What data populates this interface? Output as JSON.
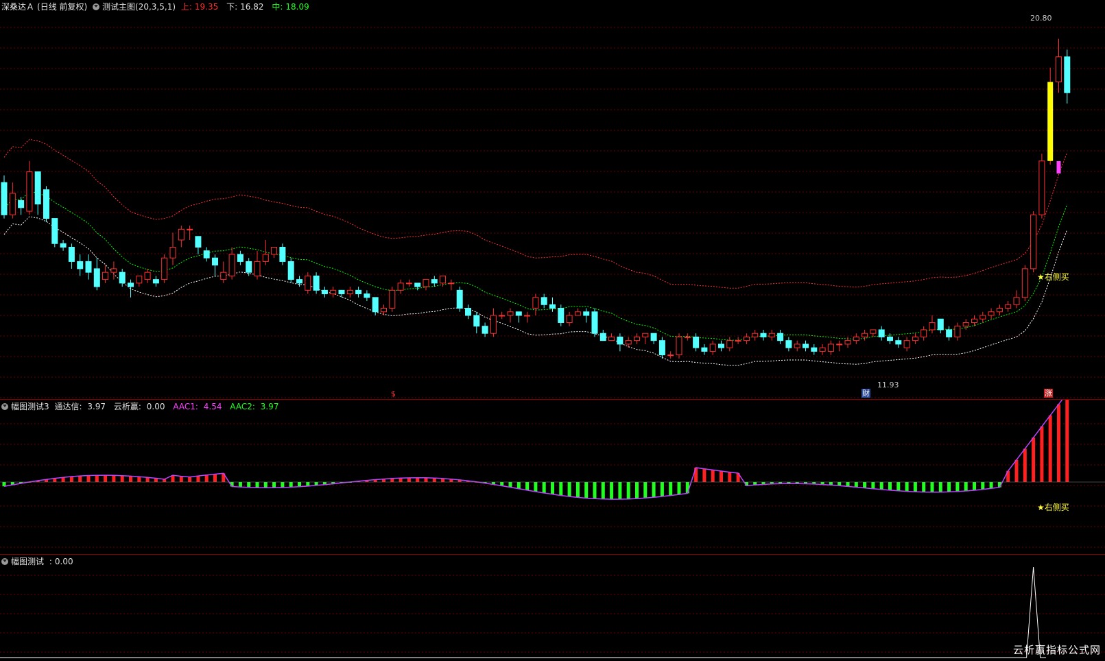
{
  "main": {
    "stock_name": "深桑达Ａ",
    "period": "(日线 前复权)",
    "indicator_name": "测试主图(20,3,5,1)",
    "upper_label": "上:",
    "upper_value": "19.35",
    "lower_label": "下:",
    "lower_value": "16.82",
    "mid_label": "中:",
    "mid_value": "18.09",
    "high_price_label": "20.80",
    "low_price_label": "11.93",
    "signal_text": "★右侧买",
    "marker_dollar": "$",
    "marker_cai": "财",
    "marker_zhang": "涨"
  },
  "sub1": {
    "title": "幅图测试3",
    "tdx_label": "通达信:",
    "tdx_value": "3.97",
    "yxy_label": "云析赢:",
    "yxy_value": "0.00",
    "aac1_label": "AAC1:",
    "aac1_value": "4.54",
    "aac2_label": "AAC2:",
    "aac2_value": "3.97",
    "signal_text": "★右侧买"
  },
  "sub2": {
    "title": "幅图测试",
    "value_label": ":",
    "value": "0.00"
  },
  "watermark": "云析赢指标公式网",
  "colors": {
    "up": "#ff3030",
    "down": "#54ffff",
    "upper_band": "#ff3030",
    "mid_band": "#00ff00",
    "lower_band": "#ffffff",
    "signal": "#ffff00",
    "macd_pos": "#ff2020",
    "macd_neg": "#20ff20",
    "magenta": "#ff40ff"
  },
  "chart_data": {
    "type": "candlestick",
    "y_range": [
      11.0,
      21.5
    ],
    "high": 20.8,
    "low": 11.93,
    "bars": [
      [
        16.8,
        15.9,
        17.0,
        15.8
      ],
      [
        15.9,
        16.5,
        16.8,
        15.8
      ],
      [
        16.3,
        16.1,
        16.4,
        15.9
      ],
      [
        16.0,
        17.1,
        17.4,
        15.9
      ],
      [
        17.1,
        16.2,
        17.1,
        15.9
      ],
      [
        16.6,
        15.8,
        16.7,
        15.7
      ],
      [
        15.8,
        15.1,
        15.8,
        15.0
      ],
      [
        15.1,
        15.0,
        15.2,
        14.9
      ],
      [
        15.0,
        14.6,
        15.1,
        14.4
      ],
      [
        14.6,
        14.4,
        14.8,
        14.2
      ],
      [
        14.6,
        14.3,
        14.8,
        14.1
      ],
      [
        14.4,
        13.9,
        14.7,
        13.8
      ],
      [
        14.1,
        14.3,
        14.5,
        14.0
      ],
      [
        14.3,
        14.4,
        14.6,
        14.1
      ],
      [
        14.3,
        14.0,
        14.4,
        13.9
      ],
      [
        14.0,
        13.9,
        14.1,
        13.6
      ],
      [
        14.0,
        14.2,
        14.2,
        13.9
      ],
      [
        14.1,
        14.3,
        14.4,
        14.0
      ],
      [
        14.1,
        14.0,
        14.2,
        13.9
      ],
      [
        14.1,
        14.7,
        14.8,
        14.0
      ],
      [
        14.7,
        15.0,
        15.4,
        14.5
      ],
      [
        15.2,
        15.5,
        15.6,
        15.0
      ],
      [
        15.5,
        15.5,
        15.6,
        15.2
      ],
      [
        15.3,
        15.0,
        15.3,
        14.8
      ],
      [
        14.9,
        14.7,
        15.0,
        14.6
      ],
      [
        14.7,
        14.5,
        14.8,
        14.2
      ],
      [
        14.1,
        14.3,
        14.6,
        14.0
      ],
      [
        14.2,
        14.8,
        15.0,
        14.1
      ],
      [
        14.8,
        14.6,
        14.9,
        14.5
      ],
      [
        14.6,
        14.3,
        14.7,
        14.2
      ],
      [
        14.2,
        14.6,
        14.9,
        14.1
      ],
      [
        14.6,
        14.8,
        15.2,
        14.5
      ],
      [
        14.8,
        15.0,
        15.0,
        14.7
      ],
      [
        15.0,
        14.6,
        15.1,
        14.5
      ],
      [
        14.6,
        14.1,
        14.7,
        14.0
      ],
      [
        14.1,
        14.0,
        14.2,
        13.9
      ],
      [
        13.8,
        14.2,
        14.3,
        13.7
      ],
      [
        14.2,
        13.8,
        14.3,
        13.7
      ],
      [
        13.8,
        13.7,
        13.9,
        13.6
      ],
      [
        13.7,
        13.8,
        13.9,
        13.6
      ],
      [
        13.8,
        13.7,
        13.8,
        13.6
      ],
      [
        13.7,
        13.8,
        13.9,
        13.6
      ],
      [
        13.8,
        13.7,
        13.9,
        13.6
      ],
      [
        13.7,
        13.6,
        13.8,
        13.5
      ],
      [
        13.6,
        13.2,
        13.6,
        13.1
      ],
      [
        13.2,
        13.3,
        13.4,
        13.1
      ],
      [
        13.3,
        13.8,
        13.9,
        13.2
      ],
      [
        13.8,
        14.0,
        14.1,
        13.7
      ],
      [
        14.0,
        14.0,
        14.1,
        13.9
      ],
      [
        14.0,
        13.9,
        14.0,
        13.8
      ],
      [
        13.9,
        14.1,
        14.1,
        13.8
      ],
      [
        14.1,
        14.0,
        14.2,
        13.9
      ],
      [
        14.0,
        14.2,
        14.2,
        13.9
      ],
      [
        14.0,
        14.0,
        14.1,
        13.8
      ],
      [
        13.8,
        13.3,
        13.9,
        13.2
      ],
      [
        13.3,
        13.1,
        13.4,
        13.0
      ],
      [
        13.1,
        12.8,
        13.2,
        12.6
      ],
      [
        12.8,
        12.6,
        12.9,
        12.5
      ],
      [
        12.6,
        13.1,
        13.3,
        12.5
      ],
      [
        13.1,
        13.1,
        13.2,
        13.0
      ],
      [
        13.1,
        13.2,
        13.3,
        12.9
      ],
      [
        13.2,
        13.1,
        13.2,
        12.9
      ],
      [
        13.1,
        13.1,
        13.2,
        12.9
      ],
      [
        13.3,
        13.6,
        13.7,
        13.1
      ],
      [
        13.6,
        13.4,
        13.7,
        13.3
      ],
      [
        13.4,
        13.3,
        13.6,
        13.2
      ],
      [
        13.3,
        12.9,
        13.4,
        12.8
      ],
      [
        12.9,
        13.1,
        13.2,
        12.8
      ],
      [
        13.1,
        13.2,
        13.3,
        13.1
      ],
      [
        13.2,
        13.1,
        13.3,
        12.9
      ],
      [
        13.2,
        12.6,
        13.3,
        12.5
      ],
      [
        12.6,
        12.4,
        12.7,
        12.4
      ],
      [
        12.4,
        12.5,
        12.6,
        12.4
      ],
      [
        12.5,
        12.3,
        12.6,
        12.1
      ],
      [
        12.3,
        12.4,
        12.5,
        12.2
      ],
      [
        12.4,
        12.5,
        12.6,
        12.3
      ],
      [
        12.5,
        12.6,
        12.6,
        12.3
      ],
      [
        12.6,
        12.4,
        12.6,
        12.3
      ],
      [
        12.4,
        12.0,
        12.5,
        11.9
      ],
      [
        12.0,
        12.0,
        12.1,
        11.9
      ],
      [
        12.0,
        12.5,
        12.6,
        11.9
      ],
      [
        12.5,
        12.5,
        12.6,
        12.4
      ],
      [
        12.5,
        12.2,
        12.6,
        12.1
      ],
      [
        12.2,
        12.1,
        12.3,
        12.0
      ],
      [
        12.1,
        12.3,
        12.4,
        12.0
      ],
      [
        12.3,
        12.2,
        12.4,
        12.1
      ],
      [
        12.2,
        12.4,
        12.5,
        12.1
      ],
      [
        12.4,
        12.4,
        12.5,
        12.3
      ],
      [
        12.4,
        12.5,
        12.6,
        12.3
      ],
      [
        12.5,
        12.6,
        12.7,
        12.4
      ],
      [
        12.6,
        12.5,
        12.7,
        12.4
      ],
      [
        12.5,
        12.6,
        12.7,
        12.4
      ],
      [
        12.6,
        12.4,
        12.7,
        12.3
      ],
      [
        12.4,
        12.2,
        12.5,
        12.1
      ],
      [
        12.2,
        12.3,
        12.4,
        12.1
      ],
      [
        12.3,
        12.2,
        12.4,
        12.1
      ],
      [
        12.2,
        12.1,
        12.3,
        12.0
      ],
      [
        12.1,
        12.2,
        12.3,
        12.0
      ],
      [
        12.1,
        12.3,
        12.4,
        12.0
      ],
      [
        12.3,
        12.3,
        12.4,
        12.1
      ],
      [
        12.3,
        12.4,
        12.5,
        12.2
      ],
      [
        12.4,
        12.5,
        12.6,
        12.3
      ],
      [
        12.5,
        12.6,
        12.7,
        12.4
      ],
      [
        12.6,
        12.7,
        12.7,
        12.5
      ],
      [
        12.7,
        12.5,
        12.8,
        12.4
      ],
      [
        12.5,
        12.4,
        12.6,
        12.3
      ],
      [
        12.4,
        12.3,
        12.5,
        12.2
      ],
      [
        12.2,
        12.4,
        12.5,
        12.1
      ],
      [
        12.4,
        12.5,
        12.6,
        12.3
      ],
      [
        12.5,
        12.7,
        12.8,
        12.4
      ],
      [
        12.7,
        12.9,
        13.1,
        12.6
      ],
      [
        13.0,
        12.7,
        13.0,
        12.6
      ],
      [
        12.7,
        12.5,
        12.8,
        12.4
      ],
      [
        12.5,
        12.8,
        12.9,
        12.4
      ],
      [
        12.8,
        12.9,
        13.0,
        12.7
      ],
      [
        12.9,
        13.0,
        13.1,
        12.8
      ],
      [
        13.0,
        13.1,
        13.2,
        12.9
      ],
      [
        13.1,
        13.2,
        13.3,
        13.0
      ],
      [
        13.2,
        13.3,
        13.4,
        13.1
      ],
      [
        13.3,
        13.4,
        13.5,
        13.2
      ],
      [
        13.4,
        13.6,
        13.8,
        13.3
      ],
      [
        13.6,
        14.4,
        14.5,
        13.5
      ],
      [
        14.4,
        15.9,
        16.0,
        14.3
      ],
      [
        15.9,
        17.4,
        17.6,
        15.8
      ],
      [
        17.4,
        19.6,
        20.0,
        17.3
      ],
      [
        19.6,
        20.3,
        20.8,
        19.3
      ],
      [
        20.3,
        19.3,
        20.5,
        19.0
      ]
    ]
  }
}
